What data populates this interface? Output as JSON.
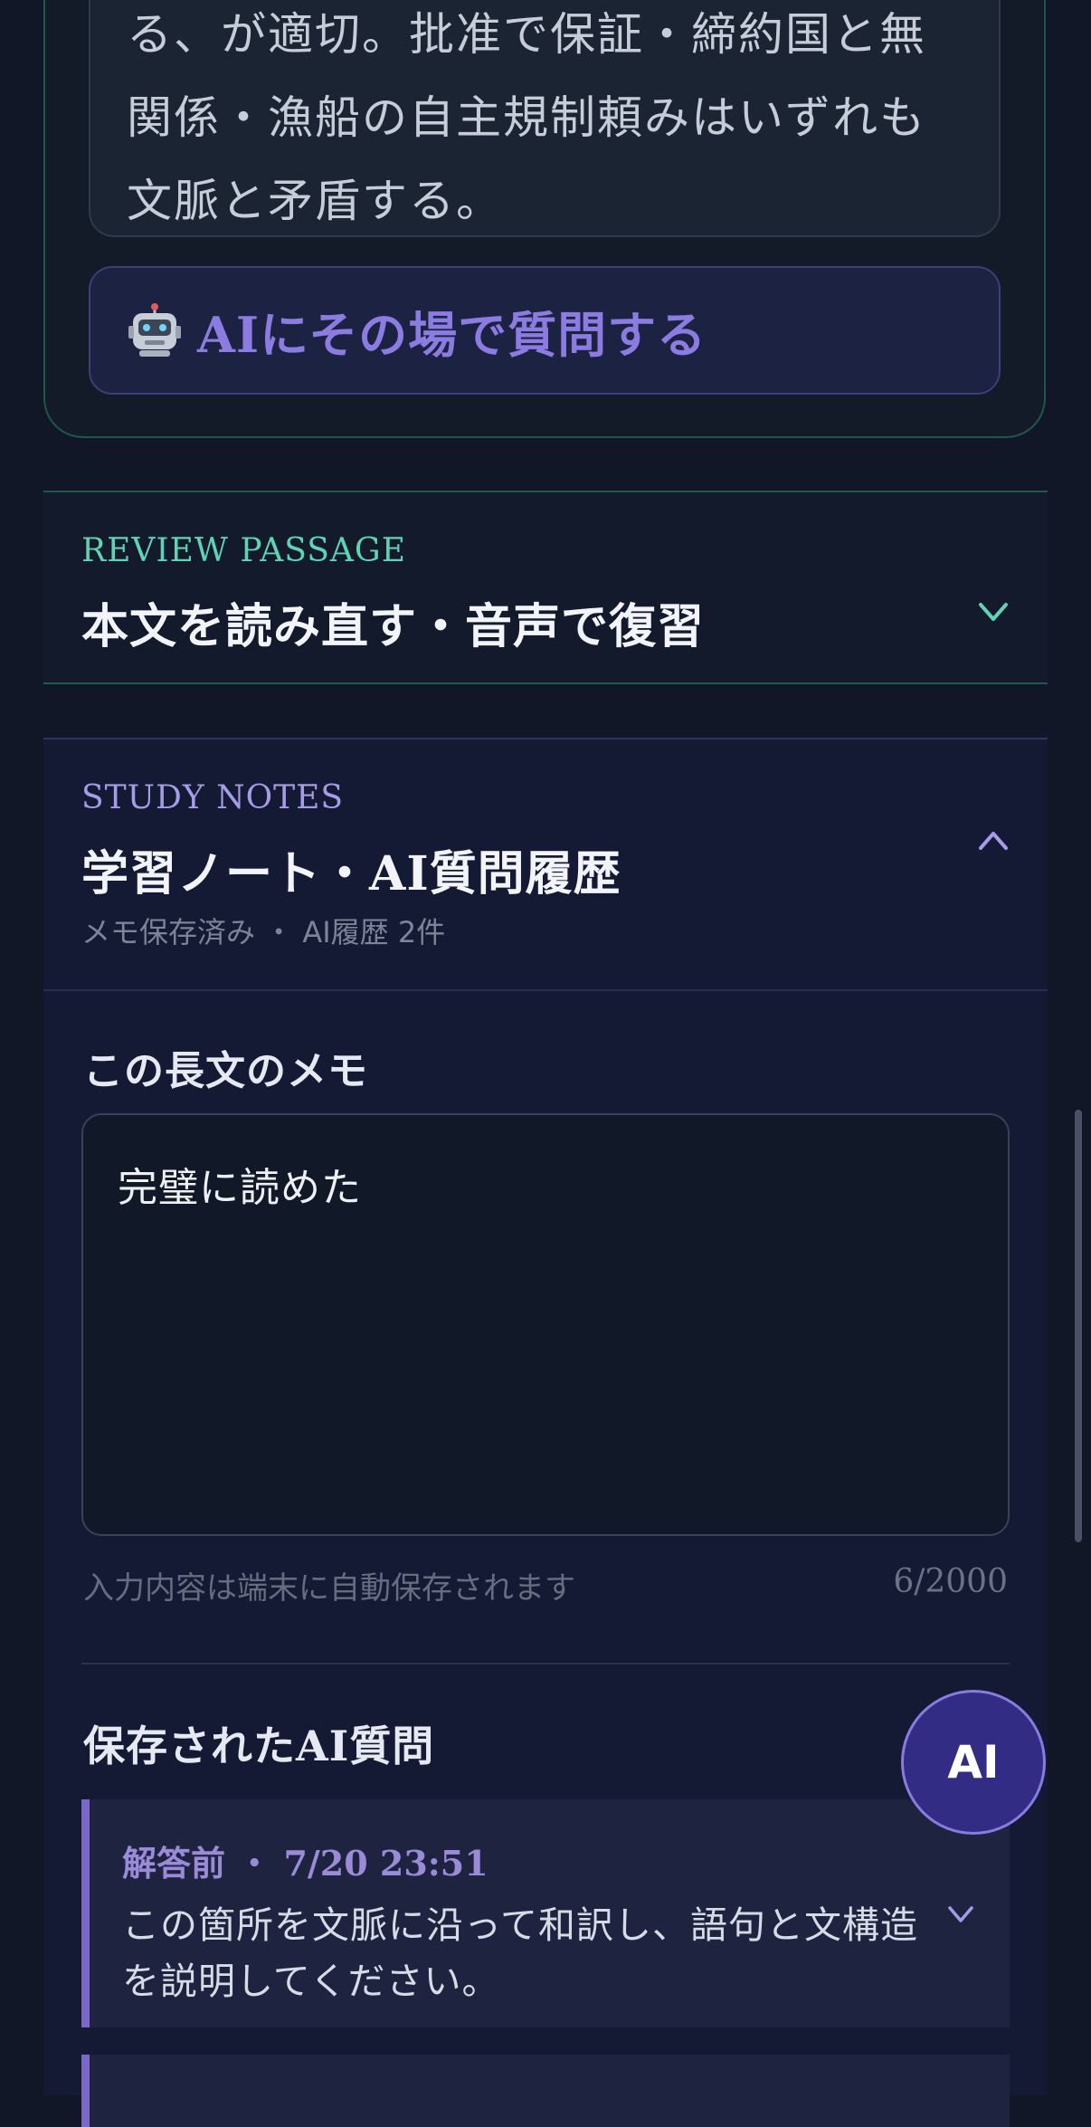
{
  "explanation": {
    "visible_text": "る、が適切。批准で保証・締約国と無\n関係・漁船の自主規制頼みはいずれも\n文脈と矛盾する。"
  },
  "ask_ai": {
    "label": "AIにその場で質問する",
    "icon": "robot-icon"
  },
  "review": {
    "kicker": "REVIEW PASSAGE",
    "title": "本文を読み直す・音声で復習",
    "expanded": false,
    "accent_color": "#5fd3b4"
  },
  "notes": {
    "kicker": "STUDY NOTES",
    "title": "学習ノート・AI質問履歴",
    "meta": "メモ保存済み ・ AI履歴 2件",
    "expanded": true,
    "accent_color": "#a79ae6",
    "memo_heading": "この長文のメモ",
    "memo_value": "完璧に読めた",
    "memo_hint": "入力内容は端末に自動保存されます",
    "memo_count": "6/2000",
    "saved_heading": "保存されたAI質問",
    "saved_questions": [
      {
        "meta": "解答前 ・ 7/20 23:51",
        "text": "この箇所を文脈に沿って和訳し、語句と文構造を説明してください。"
      },
      {
        "meta": "",
        "text": ""
      }
    ]
  },
  "fab": {
    "label": "AI"
  },
  "colors": {
    "background": "#111727",
    "teal_accent": "#5fd3b4",
    "purple_accent": "#8c7be0",
    "fab_fill": "#332c84"
  }
}
